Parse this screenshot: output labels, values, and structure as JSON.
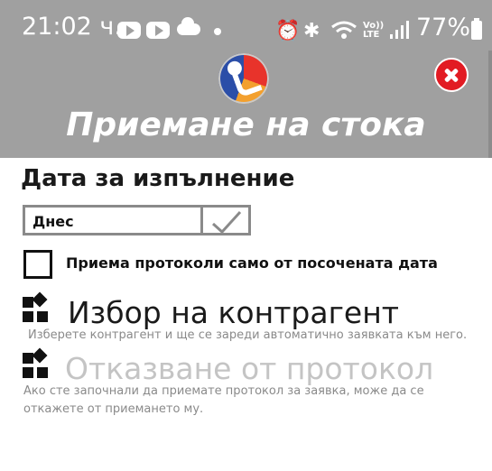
{
  "status_bar": {
    "time": "21:02 ч.",
    "battery": "77%",
    "icons": [
      "youtube-icon",
      "youtube-icon",
      "cloud-icon",
      "notification-dot-icon",
      "alarm-icon",
      "bluetooth-icon",
      "wifi-icon",
      "volte-icon",
      "signal-icon",
      "battery-icon"
    ]
  },
  "header": {
    "title": "Приемане на стока",
    "logo": "app-logo",
    "close_icon": "close-icon"
  },
  "execution_date": {
    "label": "Дата за изпълнение",
    "value": "Днес",
    "confirm_icon": "checkmark-icon"
  },
  "filter_checkbox": {
    "label": "Приема протоколи само от посочената дата",
    "checked": false
  },
  "actions": [
    {
      "title": "Избор на контрагент",
      "description": "Изберете контрагент и ще се зареди автоматично заявката към него.",
      "icon": "widgets-icon",
      "enabled": true
    },
    {
      "title": "Отказване от протокол",
      "description": "Ако сте започнали да приемате протокол за заявка, може да се откажете от приемането му.",
      "icon": "widgets-icon",
      "enabled": false
    }
  ],
  "colors": {
    "header_bg": "#a0a0a0",
    "close_red": "#e21b23",
    "text_dark": "#1a1a1a",
    "text_disabled": "#c4c4c4",
    "desc_gray": "#8a8a8a"
  }
}
